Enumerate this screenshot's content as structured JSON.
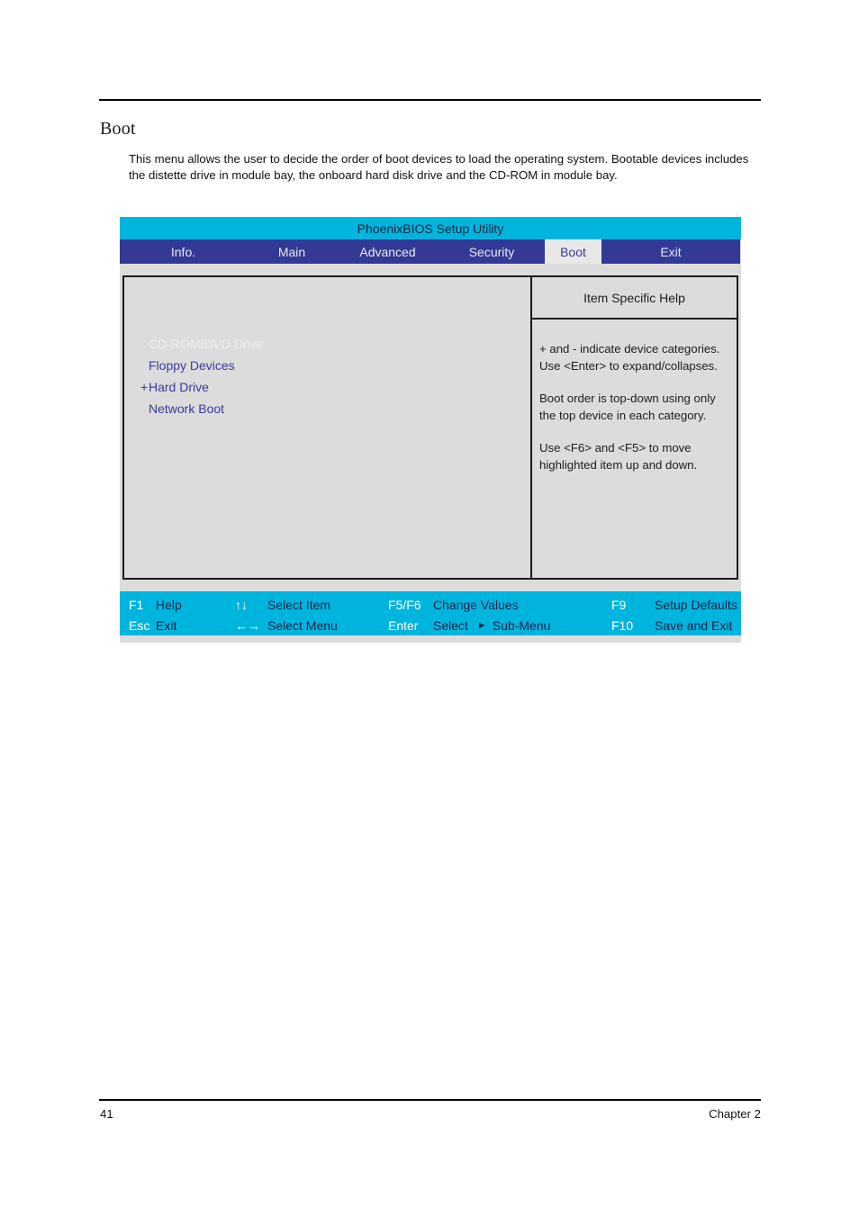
{
  "page": {
    "heading": "Boot",
    "intro": "This menu allows the user to decide the order of boot devices to load the operating system. Bootable devices includes the distette drive in module bay, the onboard hard disk drive and the CD-ROM in module bay.",
    "footer_page_number": "41",
    "footer_chapter": "Chapter 2"
  },
  "bios": {
    "title": "PhoenixBIOS Setup Utility",
    "tabs": [
      {
        "label": "Info.",
        "active": false
      },
      {
        "label": "Main",
        "active": false
      },
      {
        "label": "Advanced",
        "active": false
      },
      {
        "label": "Security",
        "active": false
      },
      {
        "label": "Boot",
        "active": true
      },
      {
        "label": "Exit",
        "active": false
      }
    ],
    "boot_items": [
      {
        "marker": "",
        "label": "CD-ROM/DVD Drive",
        "state": "highlighted"
      },
      {
        "marker": "",
        "label": "Floppy Devices",
        "state": "normal"
      },
      {
        "marker": "+",
        "label": "Hard Drive",
        "state": "normal"
      },
      {
        "marker": "",
        "label": "Network Boot",
        "state": "normal"
      }
    ],
    "help": {
      "title": "Item Specific Help",
      "paragraphs": [
        "+ and - indicate device categories. Use  <Enter> to expand/collapses.",
        "Boot order is top-down using only the top device in each category.",
        "Use <F6> and <F5> to move highlighted item up and down."
      ]
    },
    "keys": [
      {
        "key": "F1",
        "desc": "Help"
      },
      {
        "key": "Esc",
        "desc": "Exit"
      },
      {
        "key": "↑↓",
        "desc": "Select Item"
      },
      {
        "key": "←→",
        "desc": "Select Menu"
      },
      {
        "key": "F5/F6",
        "desc": "Change Values"
      },
      {
        "key": "Enter",
        "desc": "Select"
      },
      {
        "key": "F9",
        "desc": "Setup Defaults"
      },
      {
        "key": "F10",
        "desc": "Save and Exit"
      }
    ],
    "sub_menu_label": "Sub-Menu",
    "colors": {
      "title_bar": "#00b5dd",
      "tab_bar": "#333a96",
      "active_tab_bg": "#e8e8e8",
      "active_tab_text": "#3a3a9e",
      "panel_bg": "#dcdcdc",
      "item_text": "#3a3a9e",
      "key_bar": "#00b5dd"
    }
  }
}
